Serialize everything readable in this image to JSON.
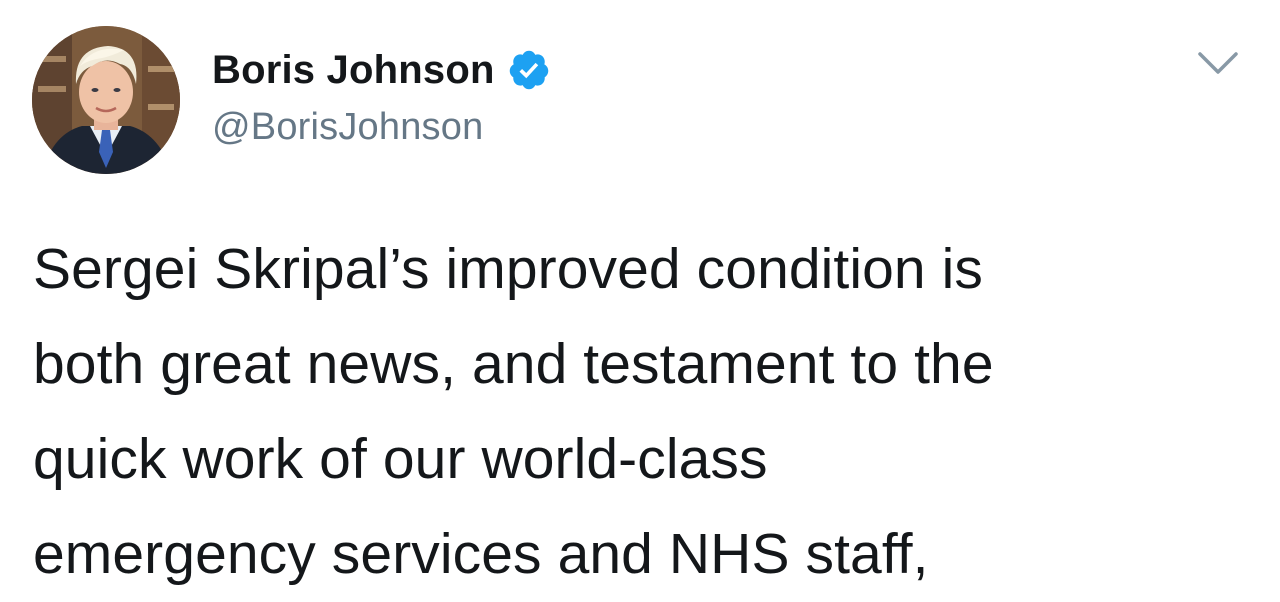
{
  "tweet": {
    "author": {
      "display_name": "Boris Johnson",
      "handle": "@BorisJohnson",
      "verified": true,
      "avatar_icon": "profile-photo"
    },
    "menu_icon": "chevron-down-icon",
    "text_lines": [
      "Sergei Skripal’s improved condition is",
      "both great news, and testament to the",
      "quick work of our world-class",
      "emergency services and NHS staff,"
    ]
  },
  "colors": {
    "verified_blue": "#1da1f2",
    "text_primary": "#14171a",
    "text_secondary": "#657786",
    "caret": "#8899a6"
  }
}
